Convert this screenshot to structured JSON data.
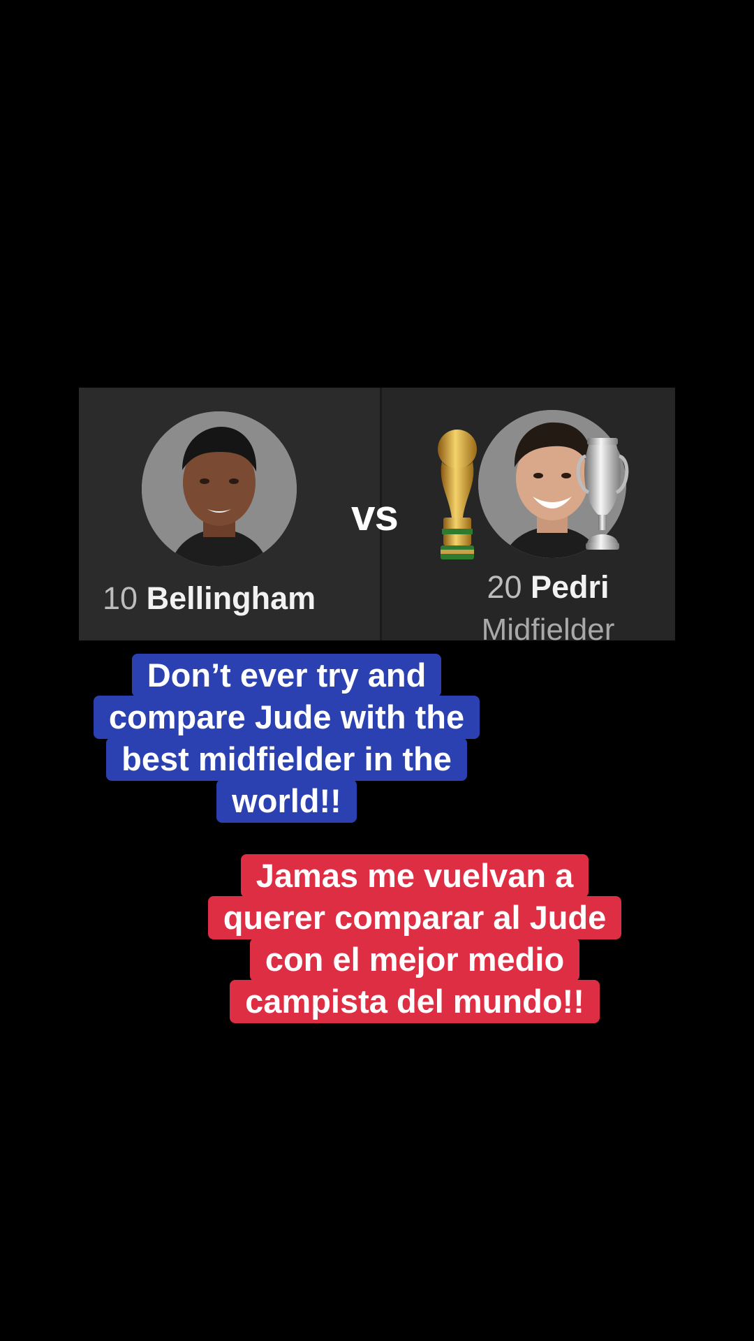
{
  "comparison": {
    "left_player": {
      "number": "10",
      "name": "Bellingham"
    },
    "versus_label": "vs",
    "right_player": {
      "number": "20",
      "name": "Pedri",
      "position": "Midfielder"
    },
    "trophies": [
      "world-cup-trophy-icon",
      "euro-trophy-icon"
    ]
  },
  "captions": {
    "english": {
      "lines": [
        "Don’t ever try and",
        "compare Jude with the",
        "best midfielder in the",
        "world!!"
      ],
      "background": "#2b41b1"
    },
    "spanish": {
      "lines": [
        "Jamas me vuelvan a",
        "querer comparar al Jude",
        "con el mejor medio",
        "campista del mundo!!"
      ],
      "background": "#de2e44"
    }
  },
  "colors": {
    "background": "#000000",
    "card_left": "#2b2b2b",
    "card_right": "#262626",
    "avatar": "#8c8c8c"
  }
}
